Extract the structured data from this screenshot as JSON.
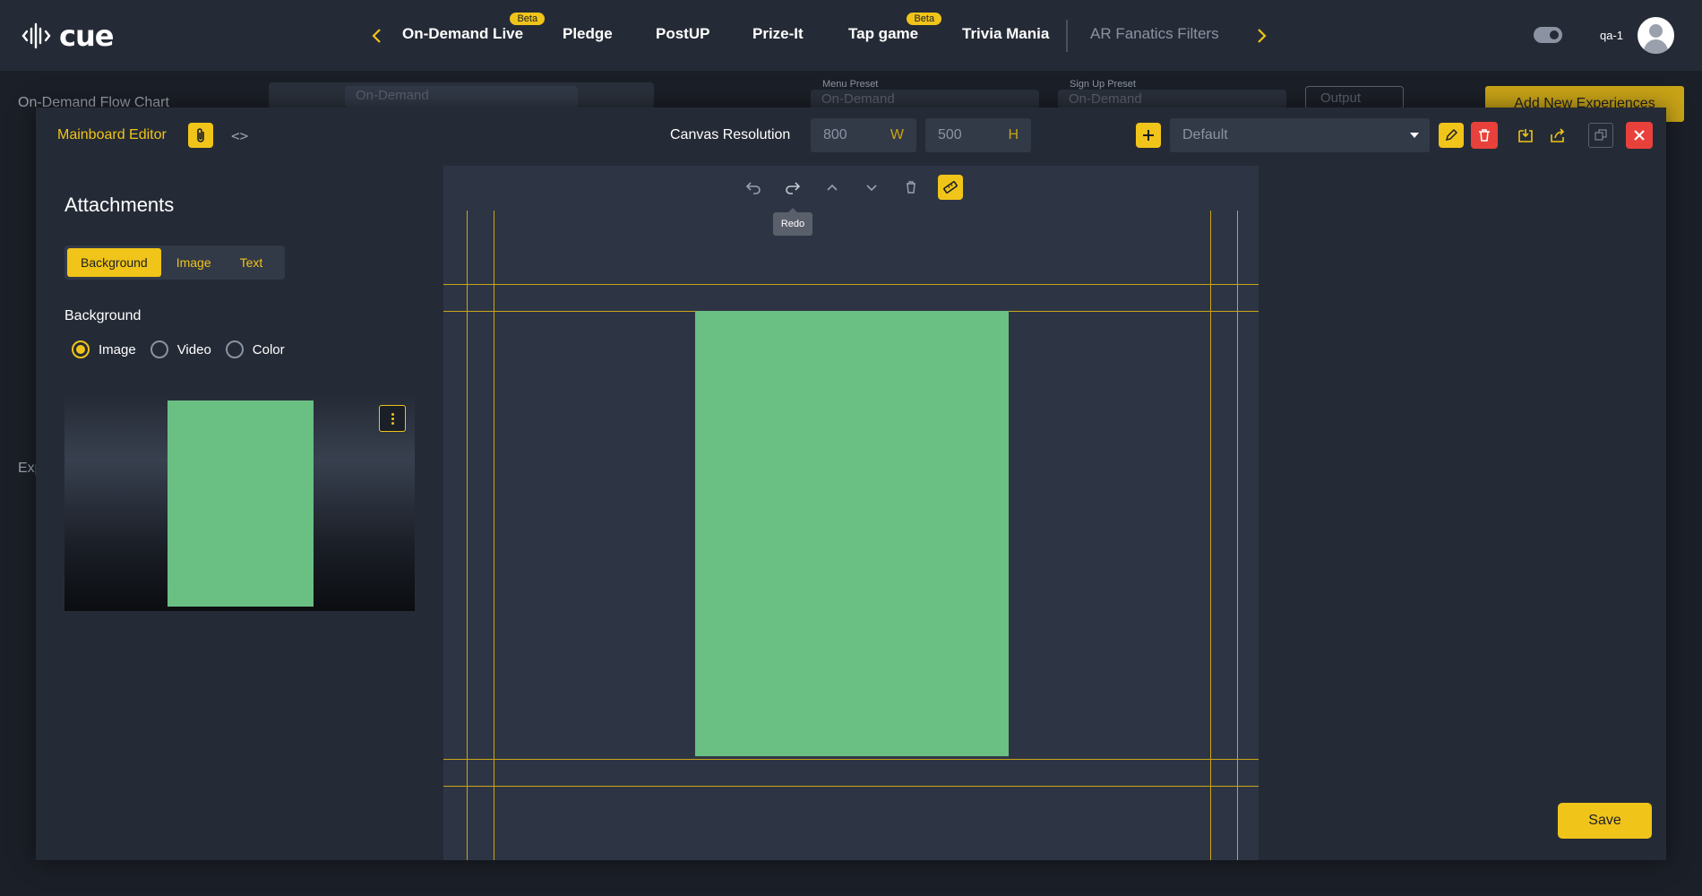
{
  "app": {
    "logo_text": "cue"
  },
  "nav": {
    "items": [
      {
        "label": "On-Demand Live",
        "badge": "Beta"
      },
      {
        "label": "Pledge"
      },
      {
        "label": "PostUP"
      },
      {
        "label": "Prize-It"
      },
      {
        "label": "Tap game",
        "badge": "Beta"
      },
      {
        "label": "Trivia Mania"
      },
      {
        "label": "AR Fanatics Filters"
      }
    ]
  },
  "user": {
    "name": "qa-1"
  },
  "background_page": {
    "title": "On-Demand Flow Chart",
    "flow_select": "On-Demand",
    "menu_preset_label": "Menu Preset",
    "menu_preset_value": "On-Demand",
    "signup_preset_label": "Sign Up Preset",
    "signup_preset_value": "On-Demand",
    "output_label": "Output",
    "add_button": "Add New Experiences",
    "section_label": "Exp"
  },
  "editor": {
    "title": "Mainboard Editor",
    "canvas_resolution_label": "Canvas Resolution",
    "width_value": "800",
    "width_unit": "W",
    "height_value": "500",
    "height_unit": "H",
    "preset_value": "Default",
    "save_label": "Save"
  },
  "attachments": {
    "title": "Attachments",
    "tabs": [
      {
        "label": "Background",
        "active": true
      },
      {
        "label": "Image",
        "active": false
      },
      {
        "label": "Text",
        "active": false
      }
    ],
    "background_label": "Background",
    "background_options": [
      {
        "label": "Image",
        "selected": true
      },
      {
        "label": "Video",
        "selected": false
      },
      {
        "label": "Color",
        "selected": false
      }
    ]
  },
  "canvas": {
    "tooltip": "Redo",
    "tools": [
      "undo-icon",
      "redo-icon",
      "move-up-icon",
      "move-down-icon",
      "trash-icon",
      "ruler-icon"
    ]
  },
  "colors": {
    "accent": "#f0c419",
    "danger": "#e8413b",
    "panel": "#252b36",
    "canvas": "#2d3544",
    "green_rect": "#6abf83"
  }
}
